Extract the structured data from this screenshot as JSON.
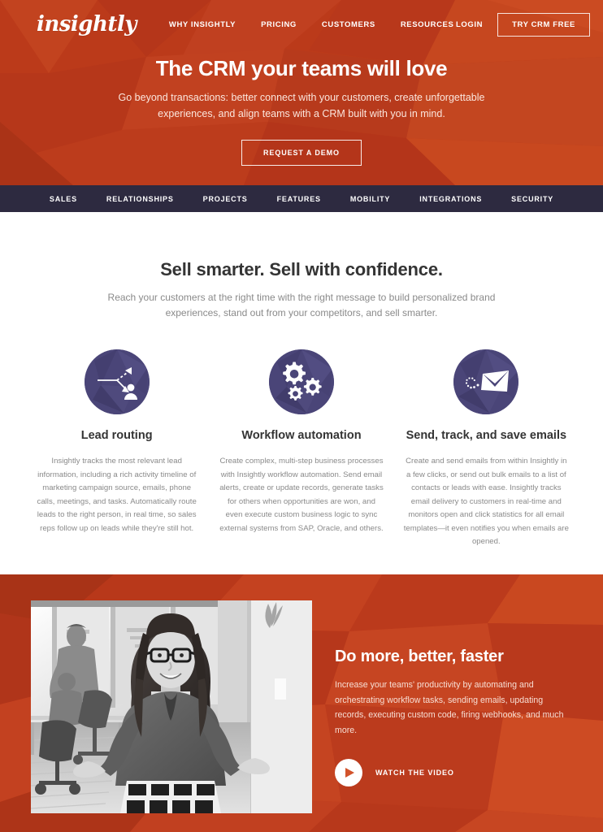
{
  "brand": {
    "logo_text": "insightly",
    "orange": "#bb3a1a",
    "orange_light": "#c03c1b",
    "navy": "#2d2a40",
    "icon_purple": "#4a4578"
  },
  "header": {
    "nav": [
      {
        "label": "WHY INSIGHTLY"
      },
      {
        "label": "PRICING"
      },
      {
        "label": "CUSTOMERS"
      },
      {
        "label": "RESOURCES"
      }
    ],
    "login_label": "LOGIN",
    "cta_label": "TRY CRM FREE"
  },
  "hero": {
    "title": "The CRM your teams will love",
    "subtitle": "Go beyond transactions: better connect with your customers, create unforgettable experiences, and align teams with a CRM built with you in mind.",
    "cta_label": "REQUEST A DEMO"
  },
  "subnav": {
    "items": [
      {
        "label": "SALES"
      },
      {
        "label": "RELATIONSHIPS"
      },
      {
        "label": "PROJECTS"
      },
      {
        "label": "FEATURES"
      },
      {
        "label": "MOBILITY"
      },
      {
        "label": "INTEGRATIONS"
      },
      {
        "label": "SECURITY"
      }
    ]
  },
  "features": {
    "title": "Sell smarter. Sell with confidence.",
    "subtitle": "Reach your customers at the right time with the right message to build personalized brand experiences, stand out from your competitors, and sell smarter.",
    "cards": [
      {
        "icon": "lead-routing-icon",
        "title": "Lead routing",
        "text": "Insightly tracks the most relevant lead information, including a rich activity timeline of marketing campaign source, emails, phone calls, meetings, and tasks. Automatically route leads to the right person, in real time, so sales reps follow up on leads while they're still hot."
      },
      {
        "icon": "gears-icon",
        "title": "Workflow automation",
        "text": "Create complex, multi-step business processes with Insightly workflow automation. Send email alerts, create or update records, generate tasks for others when opportunities are won, and even execute custom business logic to sync external systems from SAP, Oracle, and others."
      },
      {
        "icon": "envelope-icon",
        "title": "Send, track, and save emails",
        "text": "Create and send emails from within Insightly in a few clicks, or send out bulk emails to a list of contacts or leads with ease. Insightly tracks email delivery to customers in real-time and monitors open and click statistics for all email templates—it even notifies you when emails are opened."
      }
    ]
  },
  "promo": {
    "photo_alt": "Smiling woman with glasses in an open plan office, black and white photo",
    "title": "Do more, better, faster",
    "text": "Increase your teams' productivity by automating and orchestrating workflow tasks, sending emails, updating records, executing custom code, firing webhooks, and much more.",
    "watch_label": "WATCH THE VIDEO"
  }
}
